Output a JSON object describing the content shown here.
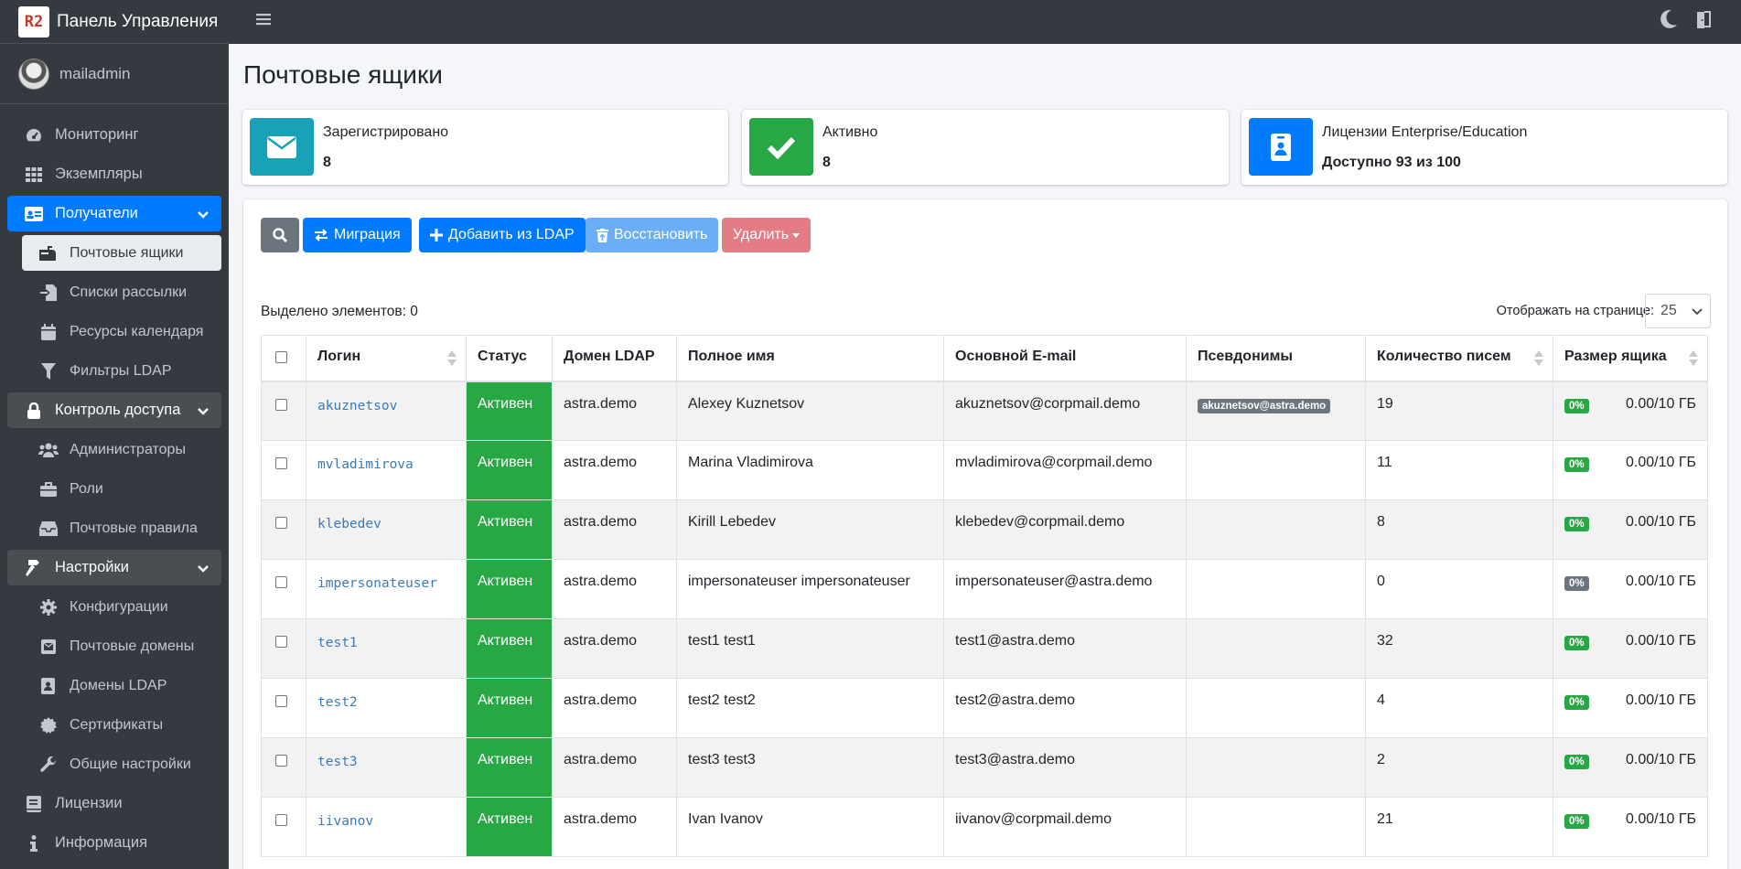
{
  "brand": {
    "logo_text": "R2",
    "title": "Панель Управления"
  },
  "user": {
    "name": "mailadmin"
  },
  "sidebar": {
    "items": [
      {
        "label": "Мониторинг",
        "icon": "gauge-icon"
      },
      {
        "label": "Экземпляры",
        "icon": "grid-icon"
      },
      {
        "label": "Получатели",
        "icon": "id-card-icon",
        "state": "active",
        "children": [
          {
            "label": "Почтовые ящики",
            "icon": "mailbox-icon",
            "state": "active"
          },
          {
            "label": "Списки рассылки",
            "icon": "file-import-icon"
          },
          {
            "label": "Ресурсы календаря",
            "icon": "calendar-icon"
          },
          {
            "label": "Фильтры LDAP",
            "icon": "filter-icon"
          }
        ]
      },
      {
        "label": "Контроль доступа",
        "icon": "lock-icon",
        "state": "open",
        "children": [
          {
            "label": "Администраторы",
            "icon": "users-icon"
          },
          {
            "label": "Роли",
            "icon": "briefcase-icon"
          },
          {
            "label": "Почтовые правила",
            "icon": "inbox-icon"
          }
        ]
      },
      {
        "label": "Настройки",
        "icon": "hammer-icon",
        "state": "open",
        "children": [
          {
            "label": "Конфигурации",
            "icon": "gear-icon"
          },
          {
            "label": "Почтовые домены",
            "icon": "envelope-square-icon"
          },
          {
            "label": "Домены LDAP",
            "icon": "address-book-icon"
          },
          {
            "label": "Сертификаты",
            "icon": "certificate-icon"
          },
          {
            "label": "Общие настройки",
            "icon": "wrench-icon"
          }
        ]
      },
      {
        "label": "Лицензии",
        "icon": "book-icon"
      },
      {
        "label": "Информация",
        "icon": "info-icon"
      }
    ]
  },
  "page": {
    "title": "Почтовые ящики"
  },
  "info_boxes": [
    {
      "label": "Зарегистрировано",
      "value": "8",
      "icon": "envelope-icon",
      "color": "#17a2b8"
    },
    {
      "label": "Активно",
      "value": "8",
      "icon": "check-icon",
      "color": "#28a745"
    },
    {
      "label": "Лицензии Enterprise/Education",
      "value": "Доступно 93 из 100",
      "icon": "id-badge-icon",
      "color": "#007bff"
    }
  ],
  "toolbar": {
    "migration_label": "Миграция",
    "add_ldap_label": "Добавить из LDAP",
    "restore_label": "Восстановить",
    "delete_label": "Удалить"
  },
  "selection": {
    "text": "Выделено элементов: 0"
  },
  "pagination": {
    "per_page_label": "Отображать на странице:",
    "per_page_value": "25"
  },
  "table": {
    "headers": [
      "Логин",
      "Статус",
      "Домен LDAP",
      "Полное имя",
      "Основной E-mail",
      "Псевдонимы",
      "Количество писем",
      "Размер ящика"
    ],
    "rows": [
      {
        "login": "akuznetsov",
        "status": "Активен",
        "domain": "astra.demo",
        "full_name": "Alexey Kuznetsov",
        "email": "akuznetsov@corpmail.demo",
        "alias": "akuznetsov@astra.demo",
        "count": "19",
        "pct": "0%",
        "size": "0.00/10 ГБ",
        "pct_color": "#28a745"
      },
      {
        "login": "mvladimirova",
        "status": "Активен",
        "domain": "astra.demo",
        "full_name": "Marina Vladimirova",
        "email": "mvladimirova@corpmail.demo",
        "alias": "",
        "count": "11",
        "pct": "0%",
        "size": "0.00/10 ГБ",
        "pct_color": "#28a745"
      },
      {
        "login": "klebedev",
        "status": "Активен",
        "domain": "astra.demo",
        "full_name": "Kirill Lebedev",
        "email": "klebedev@corpmail.demo",
        "alias": "",
        "count": "8",
        "pct": "0%",
        "size": "0.00/10 ГБ",
        "pct_color": "#28a745"
      },
      {
        "login": "impersonateuser",
        "status": "Активен",
        "domain": "astra.demo",
        "full_name": "impersonateuser impersonateuser",
        "email": "impersonateuser@astra.demo",
        "alias": "",
        "count": "0",
        "pct": "0%",
        "size": "0.00/10 ГБ",
        "pct_color": "#6c757d"
      },
      {
        "login": "test1",
        "status": "Активен",
        "domain": "astra.demo",
        "full_name": "test1 test1",
        "email": "test1@astra.demo",
        "alias": "",
        "count": "32",
        "pct": "0%",
        "size": "0.00/10 ГБ",
        "pct_color": "#28a745"
      },
      {
        "login": "test2",
        "status": "Активен",
        "domain": "astra.demo",
        "full_name": "test2 test2",
        "email": "test2@astra.demo",
        "alias": "",
        "count": "4",
        "pct": "0%",
        "size": "0.00/10 ГБ",
        "pct_color": "#28a745"
      },
      {
        "login": "test3",
        "status": "Активен",
        "domain": "astra.demo",
        "full_name": "test3 test3",
        "email": "test3@astra.demo",
        "alias": "",
        "count": "2",
        "pct": "0%",
        "size": "0.00/10 ГБ",
        "pct_color": "#28a745"
      },
      {
        "login": "iivanov",
        "status": "Активен",
        "domain": "astra.demo",
        "full_name": "Ivan Ivanov",
        "email": "iivanov@corpmail.demo",
        "alias": "",
        "count": "21",
        "pct": "0%",
        "size": "0.00/10 ГБ",
        "pct_color": "#28a745"
      }
    ]
  }
}
